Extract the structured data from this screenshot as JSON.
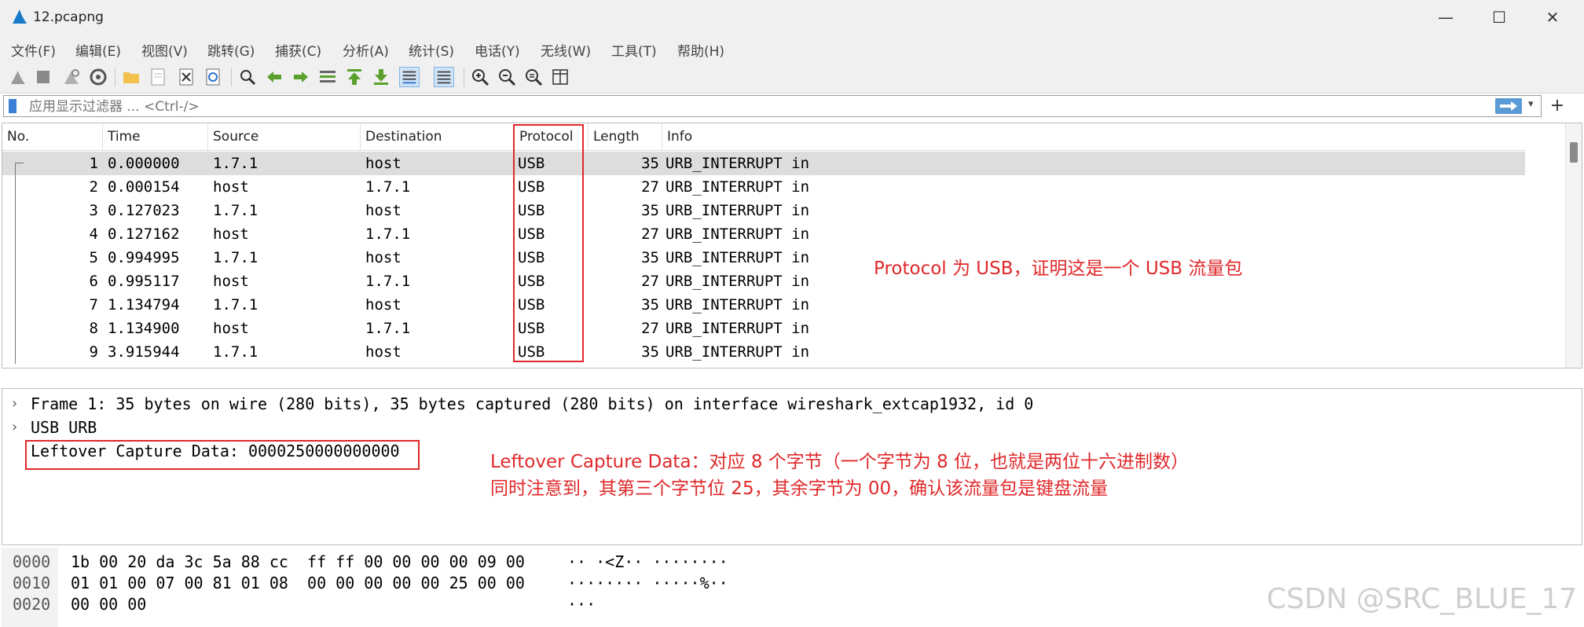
{
  "window": {
    "title": "12.pcapng",
    "minimize": "—",
    "maximize": "☐",
    "close": "✕"
  },
  "menu": [
    "文件(F)",
    "编辑(E)",
    "视图(V)",
    "跳转(G)",
    "捕获(C)",
    "分析(A)",
    "统计(S)",
    "电话(Y)",
    "无线(W)",
    "工具(T)",
    "帮助(H)"
  ],
  "filter": {
    "placeholder": "应用显示过滤器 ... <Ctrl-/>"
  },
  "packet_list": {
    "columns": [
      "No.",
      "Time",
      "Source",
      "Destination",
      "Protocol",
      "Length",
      "Info"
    ],
    "rows": [
      {
        "no": "1",
        "time": "0.000000",
        "src": "1.7.1",
        "dst": "host",
        "proto": "USB",
        "len": "35",
        "info": "URB_INTERRUPT in"
      },
      {
        "no": "2",
        "time": "0.000154",
        "src": "host",
        "dst": "1.7.1",
        "proto": "USB",
        "len": "27",
        "info": "URB_INTERRUPT in"
      },
      {
        "no": "3",
        "time": "0.127023",
        "src": "1.7.1",
        "dst": "host",
        "proto": "USB",
        "len": "35",
        "info": "URB_INTERRUPT in"
      },
      {
        "no": "4",
        "time": "0.127162",
        "src": "host",
        "dst": "1.7.1",
        "proto": "USB",
        "len": "27",
        "info": "URB_INTERRUPT in"
      },
      {
        "no": "5",
        "time": "0.994995",
        "src": "1.7.1",
        "dst": "host",
        "proto": "USB",
        "len": "35",
        "info": "URB_INTERRUPT in"
      },
      {
        "no": "6",
        "time": "0.995117",
        "src": "host",
        "dst": "1.7.1",
        "proto": "USB",
        "len": "27",
        "info": "URB_INTERRUPT in"
      },
      {
        "no": "7",
        "time": "1.134794",
        "src": "1.7.1",
        "dst": "host",
        "proto": "USB",
        "len": "35",
        "info": "URB_INTERRUPT in"
      },
      {
        "no": "8",
        "time": "1.134900",
        "src": "host",
        "dst": "1.7.1",
        "proto": "USB",
        "len": "27",
        "info": "URB_INTERRUPT in"
      },
      {
        "no": "9",
        "time": "3.915944",
        "src": "1.7.1",
        "dst": "host",
        "proto": "USB",
        "len": "35",
        "info": "URB_INTERRUPT in"
      }
    ]
  },
  "annotations": {
    "protocol_note": "Protocol 为 USB，证明这是一个 USB 流量包",
    "leftover_note_1": "Leftover Capture Data：对应 8 个字节（一个字节为 8 位，也就是两位十六进制数）",
    "leftover_note_2": "同时注意到，其第三个字节位 25，其余字节为 00，确认该流量包是键盘流量"
  },
  "details": {
    "frame": "Frame 1: 35 bytes on wire (280 bits), 35 bytes captured (280 bits) on interface wireshark_extcap1932, id 0",
    "usb": "USB URB",
    "leftover": "Leftover Capture Data: 0000250000000000"
  },
  "bytes": [
    {
      "offset": "0000",
      "hex": "1b 00 20 da 3c 5a 88 cc  ff ff 00 00 00 00 09 00",
      "ascii": "·· ·<Z·· ········"
    },
    {
      "offset": "0010",
      "hex": "01 01 00 07 00 81 01 08  00 00 00 00 00 25 00 00",
      "ascii": "········ ·····%··"
    },
    {
      "offset": "0020",
      "hex": "00 00 00",
      "ascii": "···"
    }
  ],
  "watermark": "CSDN @SRC_BLUE_17",
  "colors": {
    "annotation": "#e0282a",
    "selected_row": "#dddddd",
    "toolbar_bg": "#f0f0f0"
  }
}
